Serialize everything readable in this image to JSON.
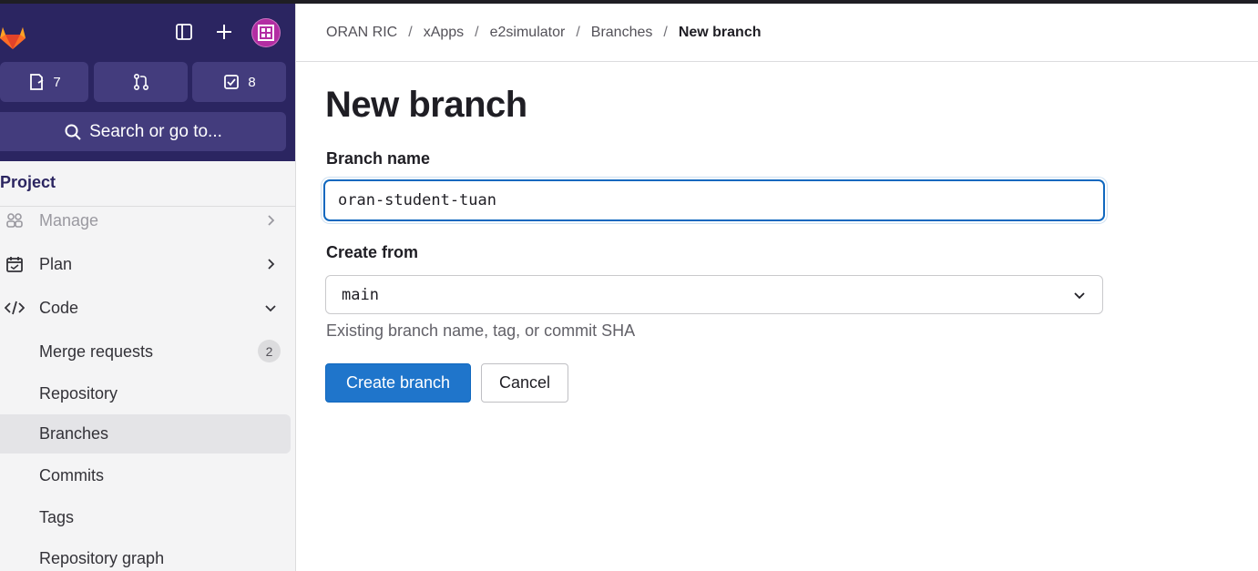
{
  "sidebar": {
    "counters": {
      "issues_count": "7",
      "todos_count": "8"
    },
    "search": {
      "label": "Search or go to..."
    },
    "section_label": "Project",
    "items": [
      {
        "label": "Manage",
        "icon": "users-icon"
      },
      {
        "label": "Plan",
        "icon": "calendar-icon"
      },
      {
        "label": "Code",
        "icon": "code-icon"
      },
      {
        "label": "Merge requests",
        "badge": "2"
      },
      {
        "label": "Repository"
      },
      {
        "label": "Branches"
      },
      {
        "label": "Commits"
      },
      {
        "label": "Tags"
      },
      {
        "label": "Repository graph"
      }
    ]
  },
  "breadcrumb": [
    "ORAN RIC",
    "xApps",
    "e2simulator",
    "Branches",
    "New branch"
  ],
  "page": {
    "title": "New branch",
    "branch_name_label": "Branch name",
    "branch_name_value": "oran-student-tuan",
    "create_from_label": "Create from",
    "create_from_value": "main",
    "create_from_help": "Existing branch name, tag, or commit SHA",
    "create_button": "Create branch",
    "cancel_button": "Cancel"
  },
  "colors": {
    "sidebar_header": "#2b2561",
    "primary_button": "#1f75cb",
    "avatar": "#b32da3"
  }
}
